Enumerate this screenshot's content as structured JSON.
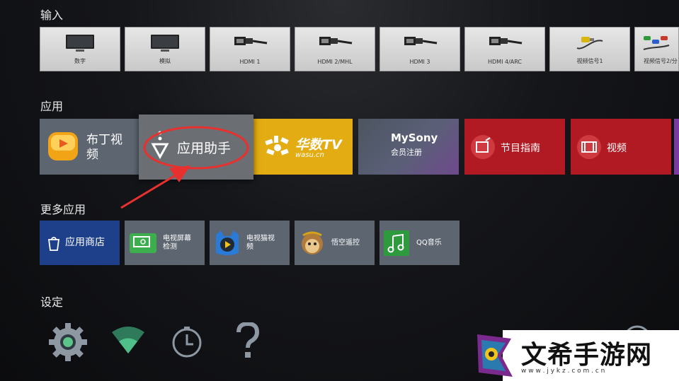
{
  "sections": {
    "inputs": "输入",
    "apps": "应用",
    "more_apps": "更多应用",
    "settings": "设定"
  },
  "inputs": [
    {
      "label": "数字",
      "icon": "tv-icon"
    },
    {
      "label": "模拟",
      "icon": "tv-icon"
    },
    {
      "label": "HDMI 1",
      "icon": "hdmi-icon"
    },
    {
      "label": "HDMI 2/MHL",
      "icon": "hdmi-icon"
    },
    {
      "label": "HDMI 3",
      "icon": "hdmi-icon"
    },
    {
      "label": "HDMI 4/ARC",
      "icon": "hdmi-icon"
    },
    {
      "label": "视频信号1",
      "icon": "av-cable-icon"
    },
    {
      "label": "视频信号2/分",
      "icon": "av-cable-icon"
    }
  ],
  "apps": [
    {
      "label": "布丁视频",
      "line1": "布丁视",
      "line2": "频"
    },
    {
      "label": "应用助手"
    },
    {
      "label": "华数TV",
      "sub": "wasu.cn"
    },
    {
      "label": "MySony",
      "sub": "会员注册"
    },
    {
      "label": "节目指南"
    },
    {
      "label": "视频"
    }
  ],
  "more_apps": [
    {
      "label": "应用商店"
    },
    {
      "line1": "电视屏幕",
      "line2": "检测"
    },
    {
      "line1": "电视猫视",
      "line2": "频"
    },
    {
      "label": "悟空遥控"
    },
    {
      "label": "QQ音乐"
    }
  ],
  "watermark": {
    "text": "文希手游网",
    "url": "w w w . j y k z . c o m . c n"
  },
  "colors": {
    "highlight_circle": "#e8312f",
    "app_tile_gray": "#5c6570",
    "wasu_yellow": "#e2ac12",
    "mysony_purple": "#6e4a8c",
    "red_tile": "#b11a23"
  }
}
